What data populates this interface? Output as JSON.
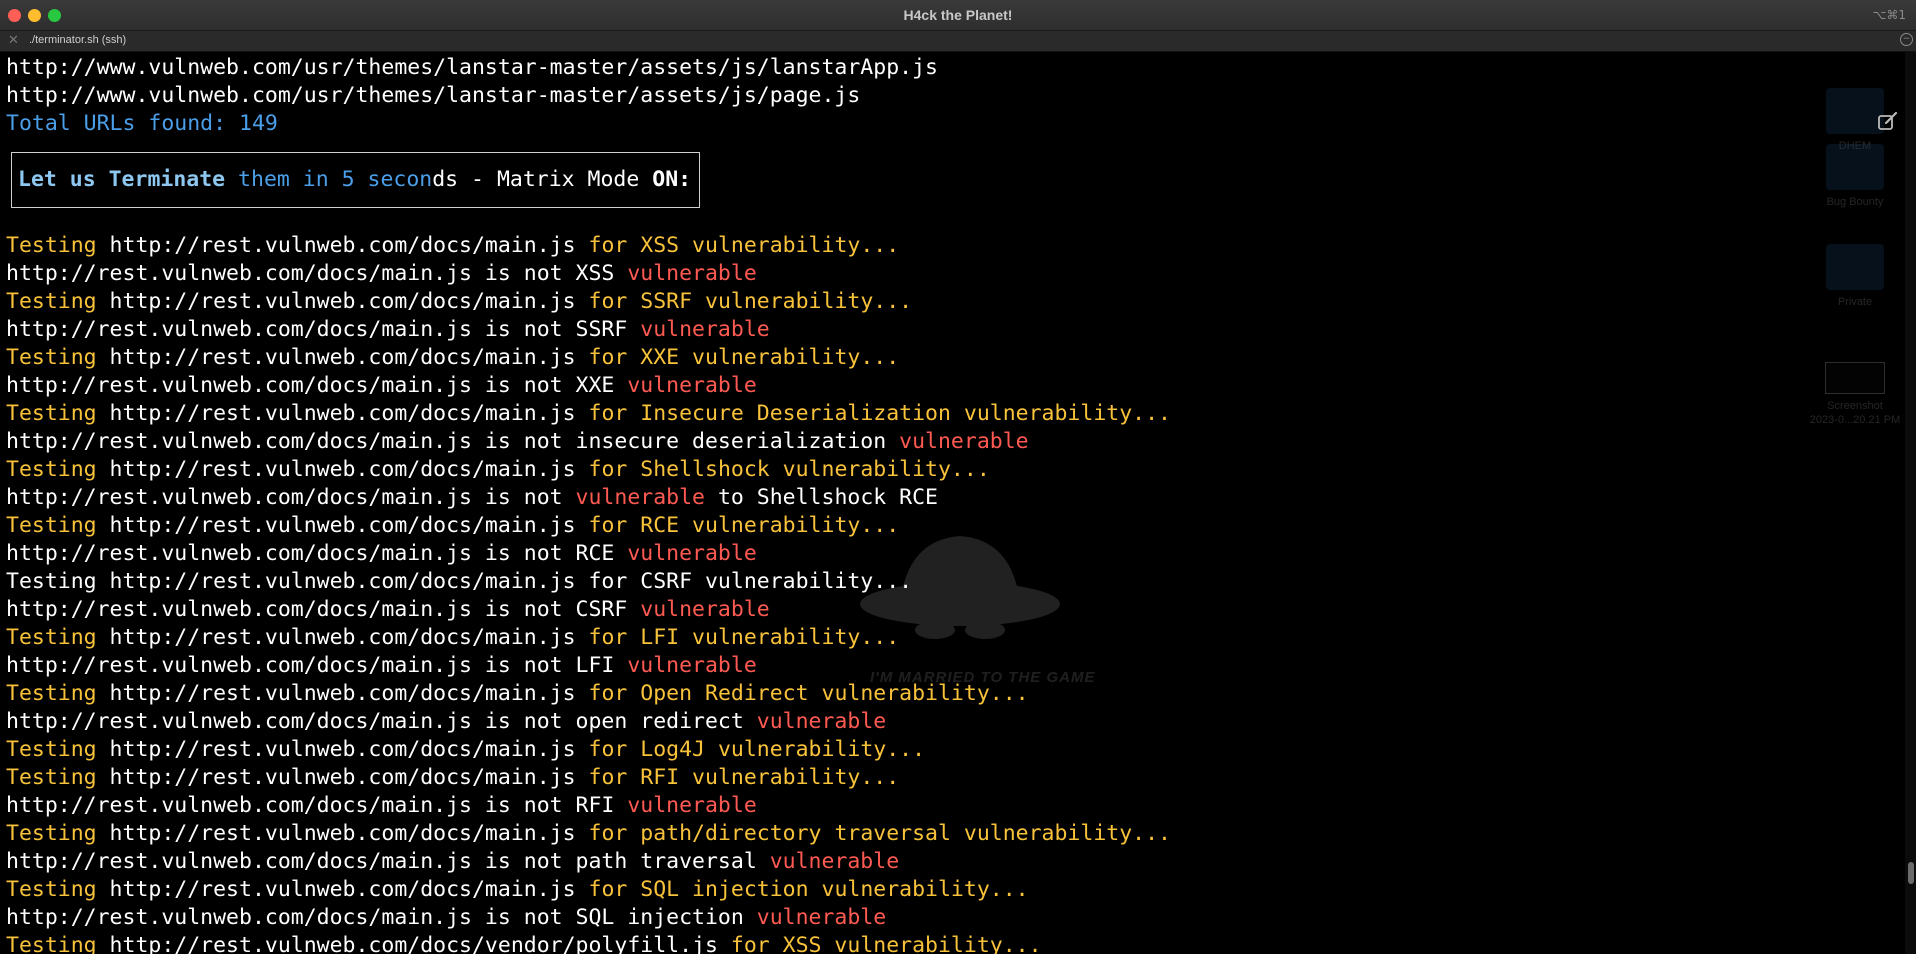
{
  "window": {
    "title": "H4ck the Planet!",
    "shortcut": "⌥⌘1"
  },
  "tab": {
    "label": "./terminator.sh (ssh)",
    "close_glyph": "✕",
    "menu_glyph": "−"
  },
  "colors": {
    "background": "#000000",
    "text": "#ffffff",
    "testing_yellow": "#f8c23a",
    "vulnerable_red": "#ff5a52",
    "info_blue": "#4b9ee8",
    "banner_light_blue": "#8ec8f0"
  },
  "terminal": {
    "url_lines": [
      "http://www.vulnweb.com/usr/themes/lanstar-master/assets/js/lanstarApp.js",
      "http://www.vulnweb.com/usr/themes/lanstar-master/assets/js/page.js"
    ],
    "total": "Total URLs found: 149",
    "banner": {
      "seg1": "Let us Terminate",
      "seg2": " them in 5 secon",
      "seg3": "ds - Matrix Mode ",
      "seg4": "ON:"
    },
    "lines": [
      {
        "kind": "test",
        "first": "Testing",
        "url": " http://rest.vulnweb.com/docs/main.js ",
        "rest": "for XSS vulnerability..."
      },
      {
        "kind": "result",
        "text": "http://rest.vulnweb.com/docs/main.js is not XSS ",
        "red": "vulnerable"
      },
      {
        "kind": "test",
        "first": "Testing",
        "url": " http://rest.vulnweb.com/docs/main.js ",
        "rest": "for SSRF vulnerability..."
      },
      {
        "kind": "result",
        "text": "http://rest.vulnweb.com/docs/main.js is not SSRF ",
        "red": "vulnerable"
      },
      {
        "kind": "test",
        "first": "Testing",
        "url": " http://rest.vulnweb.com/docs/main.js ",
        "rest": "for XXE vulnerability..."
      },
      {
        "kind": "result",
        "text": "http://rest.vulnweb.com/docs/main.js is not XXE ",
        "red": "vulnerable"
      },
      {
        "kind": "test",
        "first": "Testing",
        "url": " http://rest.vulnweb.com/docs/main.js ",
        "rest": "for Insecure Deserialization vulnerability..."
      },
      {
        "kind": "result",
        "text": "http://rest.vulnweb.com/docs/main.js is not insecure deserialization ",
        "red": "vulnerable"
      },
      {
        "kind": "test",
        "first": "Testing",
        "url": " http://rest.vulnweb.com/docs/main.js ",
        "rest": "for Shellshock vulnerability..."
      },
      {
        "kind": "result",
        "text": "http://rest.vulnweb.com/docs/main.js is not ",
        "red": "vulnerable",
        "after": " to Shellshock RCE"
      },
      {
        "kind": "test",
        "first": "Testing",
        "url": " http://rest.vulnweb.com/docs/main.js ",
        "rest": "for RCE vulnerability..."
      },
      {
        "kind": "result",
        "text": "http://rest.vulnweb.com/docs/main.js is not RCE ",
        "red": "vulnerable"
      },
      {
        "kind": "plain",
        "text": "Testing http://rest.vulnweb.com/docs/main.js for CSRF vulnerability..."
      },
      {
        "kind": "result",
        "text": "http://rest.vulnweb.com/docs/main.js is not CSRF ",
        "red": "vulnerable"
      },
      {
        "kind": "test",
        "first": "Testing",
        "url": " http://rest.vulnweb.com/docs/main.js ",
        "rest": "for LFI vulnerability..."
      },
      {
        "kind": "result",
        "text": "http://rest.vulnweb.com/docs/main.js is not LFI ",
        "red": "vulnerable"
      },
      {
        "kind": "test",
        "first": "Testing",
        "url": " http://rest.vulnweb.com/docs/main.js ",
        "rest": "for Open Redirect vulnerability..."
      },
      {
        "kind": "result",
        "text": "http://rest.vulnweb.com/docs/main.js is not open redirect ",
        "red": "vulnerable"
      },
      {
        "kind": "test",
        "first": "Testing",
        "url": " http://rest.vulnweb.com/docs/main.js ",
        "rest": "for Log4J vulnerability..."
      },
      {
        "kind": "test",
        "first": "Testing",
        "url": " http://rest.vulnweb.com/docs/main.js ",
        "rest": "for RFI vulnerability..."
      },
      {
        "kind": "result",
        "text": "http://rest.vulnweb.com/docs/main.js is not RFI ",
        "red": "vulnerable"
      },
      {
        "kind": "test",
        "first": "Testing",
        "url": " http://rest.vulnweb.com/docs/main.js ",
        "rest": "for path/directory traversal vulnerability..."
      },
      {
        "kind": "result",
        "text": "http://rest.vulnweb.com/docs/main.js is not path traversal ",
        "red": "vulnerable"
      },
      {
        "kind": "test",
        "first": "Testing",
        "url": " http://rest.vulnweb.com/docs/main.js ",
        "rest": "for SQL injection vulnerability..."
      },
      {
        "kind": "result",
        "text": "http://rest.vulnweb.com/docs/main.js is not SQL injection ",
        "red": "vulnerable"
      },
      {
        "kind": "test",
        "first": "Testing",
        "url": " http://rest.vulnweb.com/docs/vendor/polyfill.js ",
        "rest": "for XSS vulnerability..."
      }
    ]
  },
  "background_watermark": {
    "text": "I'M MARRIED TO THE GAME",
    "icon": "spy-hat-icon"
  },
  "desktop_items": [
    {
      "label": "DHEM",
      "icon": "folder-icon"
    },
    {
      "label": "Bug Bounty",
      "icon": "folder-icon"
    },
    {
      "label": "Private",
      "icon": "folder-icon"
    },
    {
      "label": "Screenshot",
      "label2": "2023-0...20.21 PM",
      "icon": "screenshot-thumbnail-icon"
    }
  ]
}
